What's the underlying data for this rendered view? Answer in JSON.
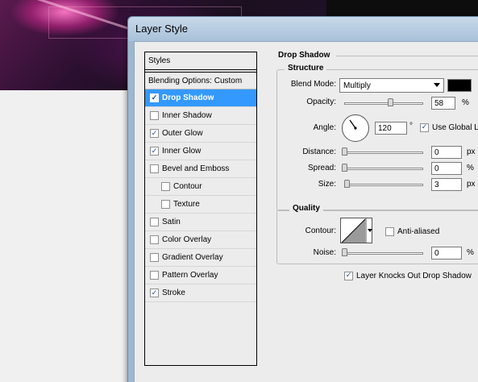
{
  "window": {
    "title": "Layer Style"
  },
  "styles_panel": {
    "header": "Styles",
    "blending_options": "Blending Options: Custom",
    "items": [
      {
        "label": "Drop Shadow",
        "checked": true,
        "active": true,
        "sub": false
      },
      {
        "label": "Inner Shadow",
        "checked": false,
        "active": false,
        "sub": false
      },
      {
        "label": "Outer Glow",
        "checked": true,
        "active": false,
        "sub": false
      },
      {
        "label": "Inner Glow",
        "checked": true,
        "active": false,
        "sub": false
      },
      {
        "label": "Bevel and Emboss",
        "checked": false,
        "active": false,
        "sub": false
      },
      {
        "label": "Contour",
        "checked": false,
        "active": false,
        "sub": true
      },
      {
        "label": "Texture",
        "checked": false,
        "active": false,
        "sub": true
      },
      {
        "label": "Satin",
        "checked": false,
        "active": false,
        "sub": false
      },
      {
        "label": "Color Overlay",
        "checked": false,
        "active": false,
        "sub": false
      },
      {
        "label": "Gradient Overlay",
        "checked": false,
        "active": false,
        "sub": false
      },
      {
        "label": "Pattern Overlay",
        "checked": false,
        "active": false,
        "sub": false
      },
      {
        "label": "Stroke",
        "checked": true,
        "active": false,
        "sub": false
      }
    ]
  },
  "drop_shadow": {
    "section_title": "Drop Shadow",
    "structure": {
      "title": "Structure",
      "blend_mode_label": "Blend Mode:",
      "blend_mode_value": "Multiply",
      "shadow_color": "#000000",
      "opacity_label": "Opacity:",
      "opacity_value": "58",
      "opacity_level": 58,
      "opacity_unit": "%",
      "angle_label": "Angle:",
      "angle_value": "120",
      "angle_unit": "°",
      "use_global_light_label": "Use Global Light",
      "use_global_light_checked": true,
      "distance_label": "Distance:",
      "distance_value": "0",
      "distance_unit": "px",
      "spread_label": "Spread:",
      "spread_value": "0",
      "spread_unit": "%",
      "size_label": "Size:",
      "size_value": "3",
      "size_unit": "px"
    },
    "quality": {
      "title": "Quality",
      "contour_label": "Contour:",
      "anti_aliased_label": "Anti-aliased",
      "anti_aliased_checked": false,
      "noise_label": "Noise:",
      "noise_value": "0",
      "noise_unit": "%"
    },
    "knockout_label": "Layer Knocks Out Drop Shadow",
    "knockout_checked": true
  }
}
